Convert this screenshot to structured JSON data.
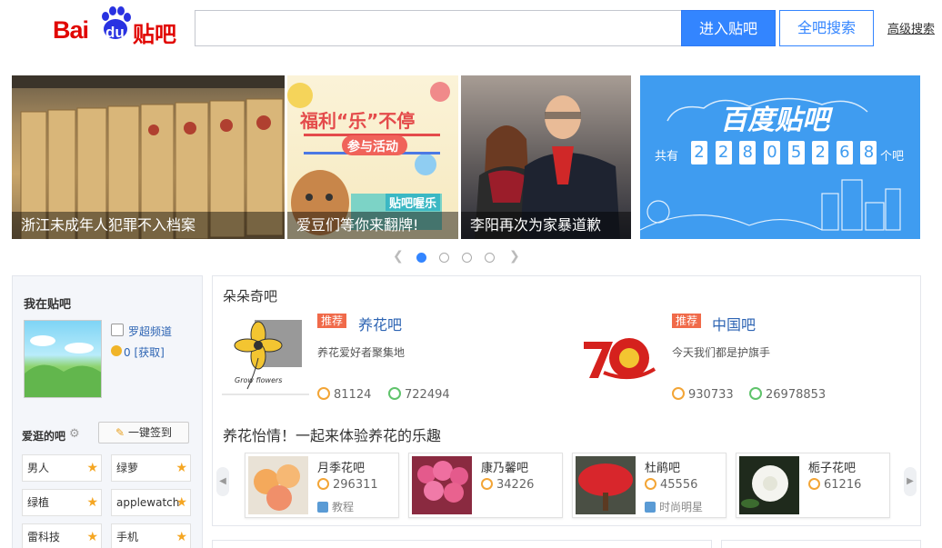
{
  "header": {
    "logo_bai": "Bai",
    "logo_du": "du",
    "logo_tieba": "贴吧",
    "search_placeholder": "",
    "enter_button": "进入贴吧",
    "all_search_button": "全吧搜索",
    "advanced_search": "高级搜索"
  },
  "banners": [
    {
      "caption": "浙江未成年人犯罪不入档案"
    },
    {
      "caption": "爱豆们等你来翻牌!",
      "headline": "福利“乐”不停",
      "subline": "参与活动",
      "badge": "贴吧喔乐"
    },
    {
      "caption": "李阳再次为家暴道歉"
    },
    {
      "title": "百度贴吧",
      "prefix": "共有",
      "digits": [
        "2",
        "2",
        "8",
        "0",
        "5",
        "2",
        "6",
        "8"
      ],
      "suffix": "个吧"
    }
  ],
  "carousel": {
    "total": 4,
    "active": 1
  },
  "sidebar": {
    "title": "我在贴吧",
    "username": "罗超频道",
    "coins": "0",
    "coin_link": "[获取]",
    "fav_title": "爱逛的吧",
    "sign_button": "一键签到",
    "fav_items": [
      "男人",
      "绿萝",
      "绿植",
      "applewatch",
      "雷科技",
      "手机"
    ]
  },
  "main": {
    "section_title": "朵朵奇吧",
    "featured": [
      {
        "tag": "推荐",
        "name": "养花吧",
        "desc": "养花爱好者聚集地",
        "members": "81124",
        "posts": "722494",
        "img_caption": "Grow flowers"
      },
      {
        "tag": "推荐",
        "name": "中国吧",
        "desc": "今天我们都是护旗手",
        "members": "930733",
        "posts": "26978853"
      }
    ],
    "sub_title": "养花怡情！一起来体验养花的乐趣",
    "cards": [
      {
        "name": "月季花吧",
        "members": "296311",
        "tag": "教程"
      },
      {
        "name": "康乃馨吧",
        "members": "34226",
        "tag": ""
      },
      {
        "name": "杜鹃吧",
        "members": "45556",
        "tag": "时尚明星"
      },
      {
        "name": "栀子花吧",
        "members": "61216",
        "tag": ""
      }
    ]
  }
}
